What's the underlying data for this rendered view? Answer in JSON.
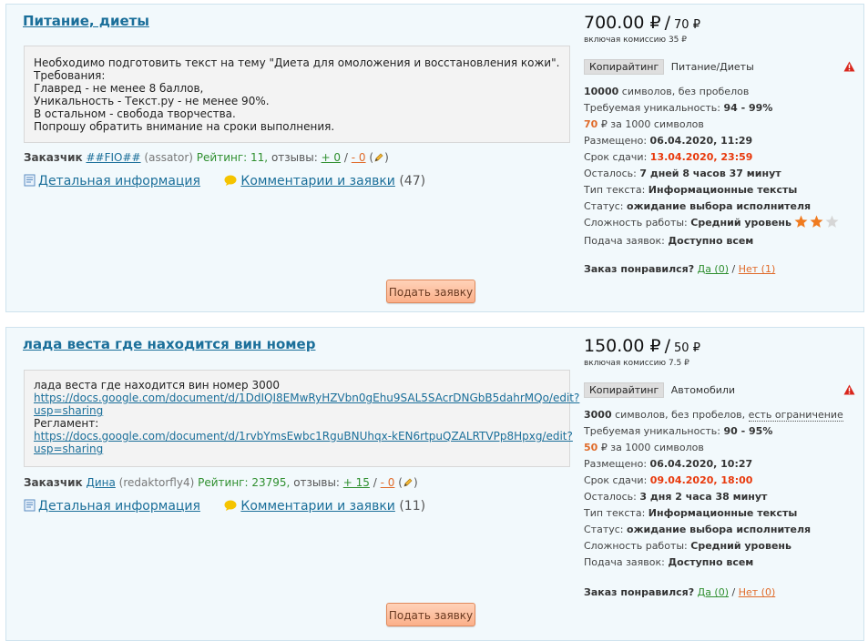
{
  "orders": [
    {
      "title": "Питание, диеты",
      "description_lines": [
        "Необходимо подготовить текст на тему \"Диета для омоложения и восстановления кожи\".",
        "Требования:",
        "Главред - не менее 8 баллов,",
        "Уникальность - Текст.ру - не менее 90%.",
        "В остальном - свобода творчества.",
        "Попрошу обратить внимание на сроки выполнения."
      ],
      "customer": {
        "label": "Заказчик",
        "name": "##FIO##",
        "login": "(assator)",
        "rating_label": "Рейтинг:",
        "rating": "11,",
        "reviews_label": "отзывы:",
        "reviews_pos": "+ 0",
        "reviews_sep": "/",
        "reviews_neg": "- 0",
        "paren_open": "(",
        "paren_close": ")"
      },
      "details_link": "Детальная информация",
      "comments_link": "Комментарии и заявки",
      "comments_count": "(47)",
      "apply_button": "Подать заявку",
      "price": {
        "total": "700.00 ₽",
        "sep": "/",
        "per_1000": "70 ₽",
        "commission": "включая комиссию 35 ₽"
      },
      "tag": "Копирайтинг",
      "category": "Питание/Диеты",
      "meta": {
        "chars": "10000",
        "chars_suffix": "символов, без пробелов",
        "limit": "",
        "uniq_label": "Требуемая уникальность:",
        "uniq": "94 - 99%",
        "rate": "70",
        "rate_suffix": "₽ за 1000 символов",
        "posted_label": "Размещено:",
        "posted": "06.04.2020, 11:29",
        "due_label": "Срок сдачи:",
        "due": "13.04.2020, 23:59",
        "left_label": "Осталось:",
        "left": "7 дней 8 часов 37 минут",
        "type_label": "Тип текста:",
        "type": "Информационные тексты",
        "status_label": "Статус:",
        "status": "ожидание выбора исполнителя",
        "difficulty_label": "Сложность работы:",
        "difficulty": "Средний уровень",
        "stars_filled": 2,
        "stars_total": 3,
        "submit_label": "Подача заявок:",
        "submit": "Доступно всем"
      },
      "liked": {
        "label": "Заказ понравился?",
        "yes": "Да (0)",
        "sep": "/",
        "no": "Нет (1)"
      }
    },
    {
      "title": "лада веста где находится вин номер",
      "description_lines": [
        "лада веста где находится вин номер 3000"
      ],
      "desc_link1_a": "https://docs.google.com/document/d/1DdIQI8EMwRyHZVbn0gEhu9SAL5SAcrDNGbB5dahrMQo/edit?",
      "desc_link1_b": "usp=sharing",
      "desc_reglament": "Регламент:",
      "desc_link2_a": "https://docs.google.com/document/d/1rvbYmsEwbc1RguBNUhqx-kEN6rtpuQZALRTVPp8Hpxg/edit?",
      "desc_link2_b": "usp=sharing",
      "customer": {
        "label": "Заказчик",
        "name": "Дина",
        "login": "(redaktorfly4)",
        "rating_label": "Рейтинг:",
        "rating": "23795,",
        "reviews_label": "отзывы:",
        "reviews_pos": "+ 15",
        "reviews_sep": "/",
        "reviews_neg": "- 0",
        "paren_open": "(",
        "paren_close": ")"
      },
      "details_link": "Детальная информация",
      "comments_link": "Комментарии и заявки",
      "comments_count": "(11)",
      "apply_button": "Подать заявку",
      "price": {
        "total": "150.00 ₽",
        "sep": "/",
        "per_1000": "50 ₽",
        "commission": "включая комиссию 7.5 ₽"
      },
      "tag": "Копирайтинг",
      "category": "Автомобили",
      "meta": {
        "chars": "3000",
        "chars_suffix": "символов, без пробелов,",
        "limit": "есть ограничение",
        "uniq_label": "Требуемая уникальность:",
        "uniq": "90 - 95%",
        "rate": "50",
        "rate_suffix": "₽ за 1000 символов",
        "posted_label": "Размещено:",
        "posted": "06.04.2020, 10:27",
        "due_label": "Срок сдачи:",
        "due": "09.04.2020, 18:00",
        "left_label": "Осталось:",
        "left": "3 дня 2 часа 38 минут",
        "type_label": "Тип текста:",
        "type": "Информационные тексты",
        "status_label": "Статус:",
        "status": "ожидание выбора исполнителя",
        "difficulty_label": "Сложность работы:",
        "difficulty": "Средний уровень",
        "stars_filled": 0,
        "stars_total": 0,
        "submit_label": "Подача заявок:",
        "submit": "Доступно всем"
      },
      "liked": {
        "label": "Заказ понравился?",
        "yes": "Да (0)",
        "sep": "/",
        "no": "Нет (0)"
      }
    }
  ],
  "colors": {
    "link": "#1b6f9a",
    "accent_orange": "#e06b2a",
    "deadline_red": "#e8390c",
    "positive_green": "#2f8f2f",
    "card_bg": "#f2f9fc",
    "card_border": "#cfe3ee"
  }
}
